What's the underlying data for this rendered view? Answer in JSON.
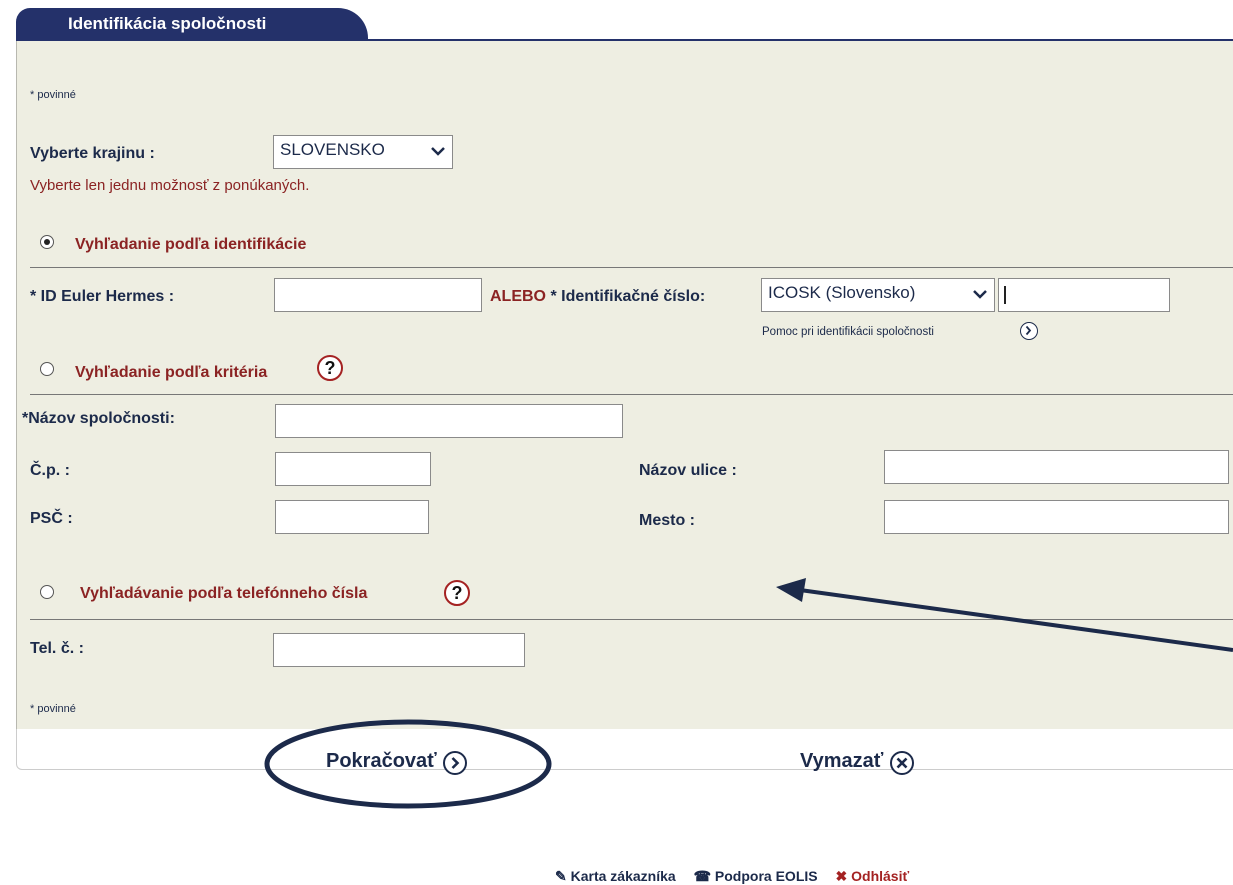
{
  "tab": {
    "title": "Identifikácia spoločnosti"
  },
  "required_note_top": "* povinné",
  "country": {
    "label": "Vyberte krajinu :",
    "value": "SLOVENSKO",
    "hint": "Vyberte len jednu možnosť z ponúkaných."
  },
  "search_by_id": {
    "radio_label": "Vyhľadanie podľa identifikácie",
    "selected": true,
    "eh_label": "* ID Euler Hermes :",
    "eh_value": "",
    "or_label": "ALEBO",
    "ident_label": "* Identifikačné číslo:",
    "ident_type": "ICOSK (Slovensko)",
    "ident_value": "",
    "help_link": "Pomoc pri identifikácii spoločnosti"
  },
  "search_by_criteria": {
    "radio_label": "Vyhľadanie podľa kritéria",
    "selected": false,
    "company_name_label": "*Názov spoločnosti:",
    "company_name_value": "",
    "cp_label": "Č.p. :",
    "cp_value": "",
    "street_label": "Názov ulice :",
    "street_value": "",
    "psc_label": "PSČ :",
    "psc_value": "",
    "city_label": "Mesto :",
    "city_value": ""
  },
  "search_by_phone": {
    "radio_label": "Vyhľadávanie podľa telefónneho čísla",
    "selected": false,
    "phone_label": "Tel. č. :",
    "phone_value": ""
  },
  "required_note_bottom": "* povinné",
  "actions": {
    "continue": "Pokračovať",
    "clear": "Vymazať"
  },
  "footer": {
    "customer_card": "Karta zákazníka",
    "support": "Podpora EOLIS",
    "logout": "Odhlásiť"
  },
  "colors": {
    "tab": "#24316a",
    "panel": "#eeeee2",
    "accent_red": "#8b2323",
    "annotation": "#1c2a4a"
  }
}
